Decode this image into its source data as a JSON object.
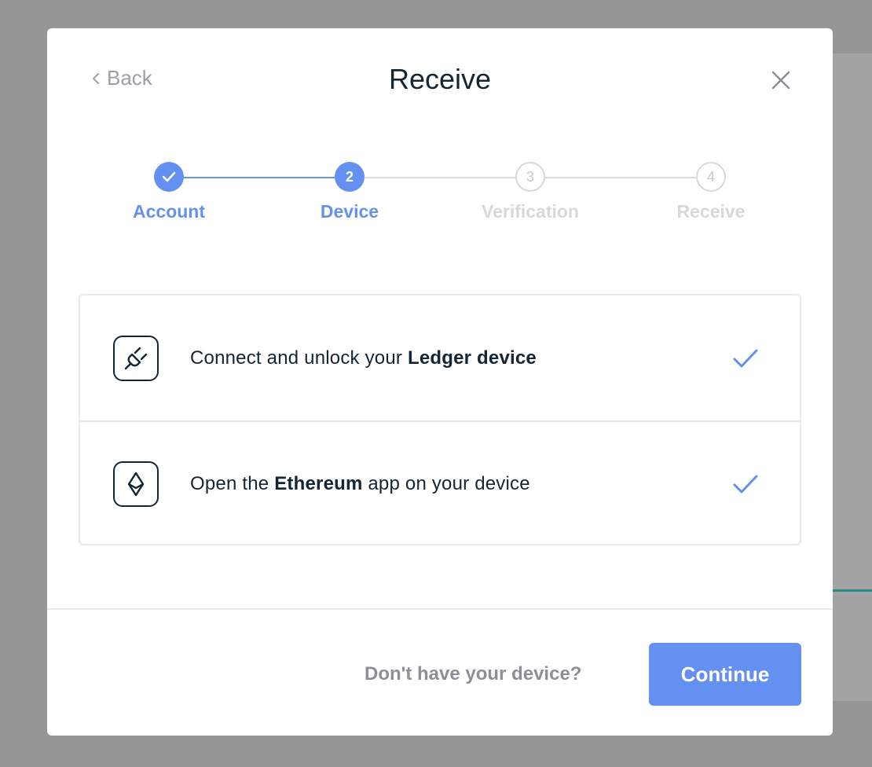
{
  "modal": {
    "title": "Receive",
    "back_label": "Back"
  },
  "stepper": {
    "steps": [
      {
        "number": "1",
        "label": "Account",
        "state": "done"
      },
      {
        "number": "2",
        "label": "Device",
        "state": "active"
      },
      {
        "number": "3",
        "label": "Verification",
        "state": "pending"
      },
      {
        "number": "4",
        "label": "Receive",
        "state": "pending"
      }
    ]
  },
  "checklist": {
    "items": [
      {
        "prefix": "Connect and unlock your ",
        "bold": "Ledger device",
        "suffix": "",
        "icon": "usb-plug-icon",
        "done": true
      },
      {
        "prefix": "Open the ",
        "bold": "Ethereum",
        "suffix": " app on your device",
        "icon": "ethereum-icon",
        "done": true
      }
    ]
  },
  "footer": {
    "help_link": "Don't have your device?",
    "continue_label": "Continue"
  },
  "colors": {
    "accent": "#6490f1",
    "text": "#142533",
    "muted": "#9aa0a6",
    "pending": "#d8d8d8",
    "overlay": "#969696"
  }
}
